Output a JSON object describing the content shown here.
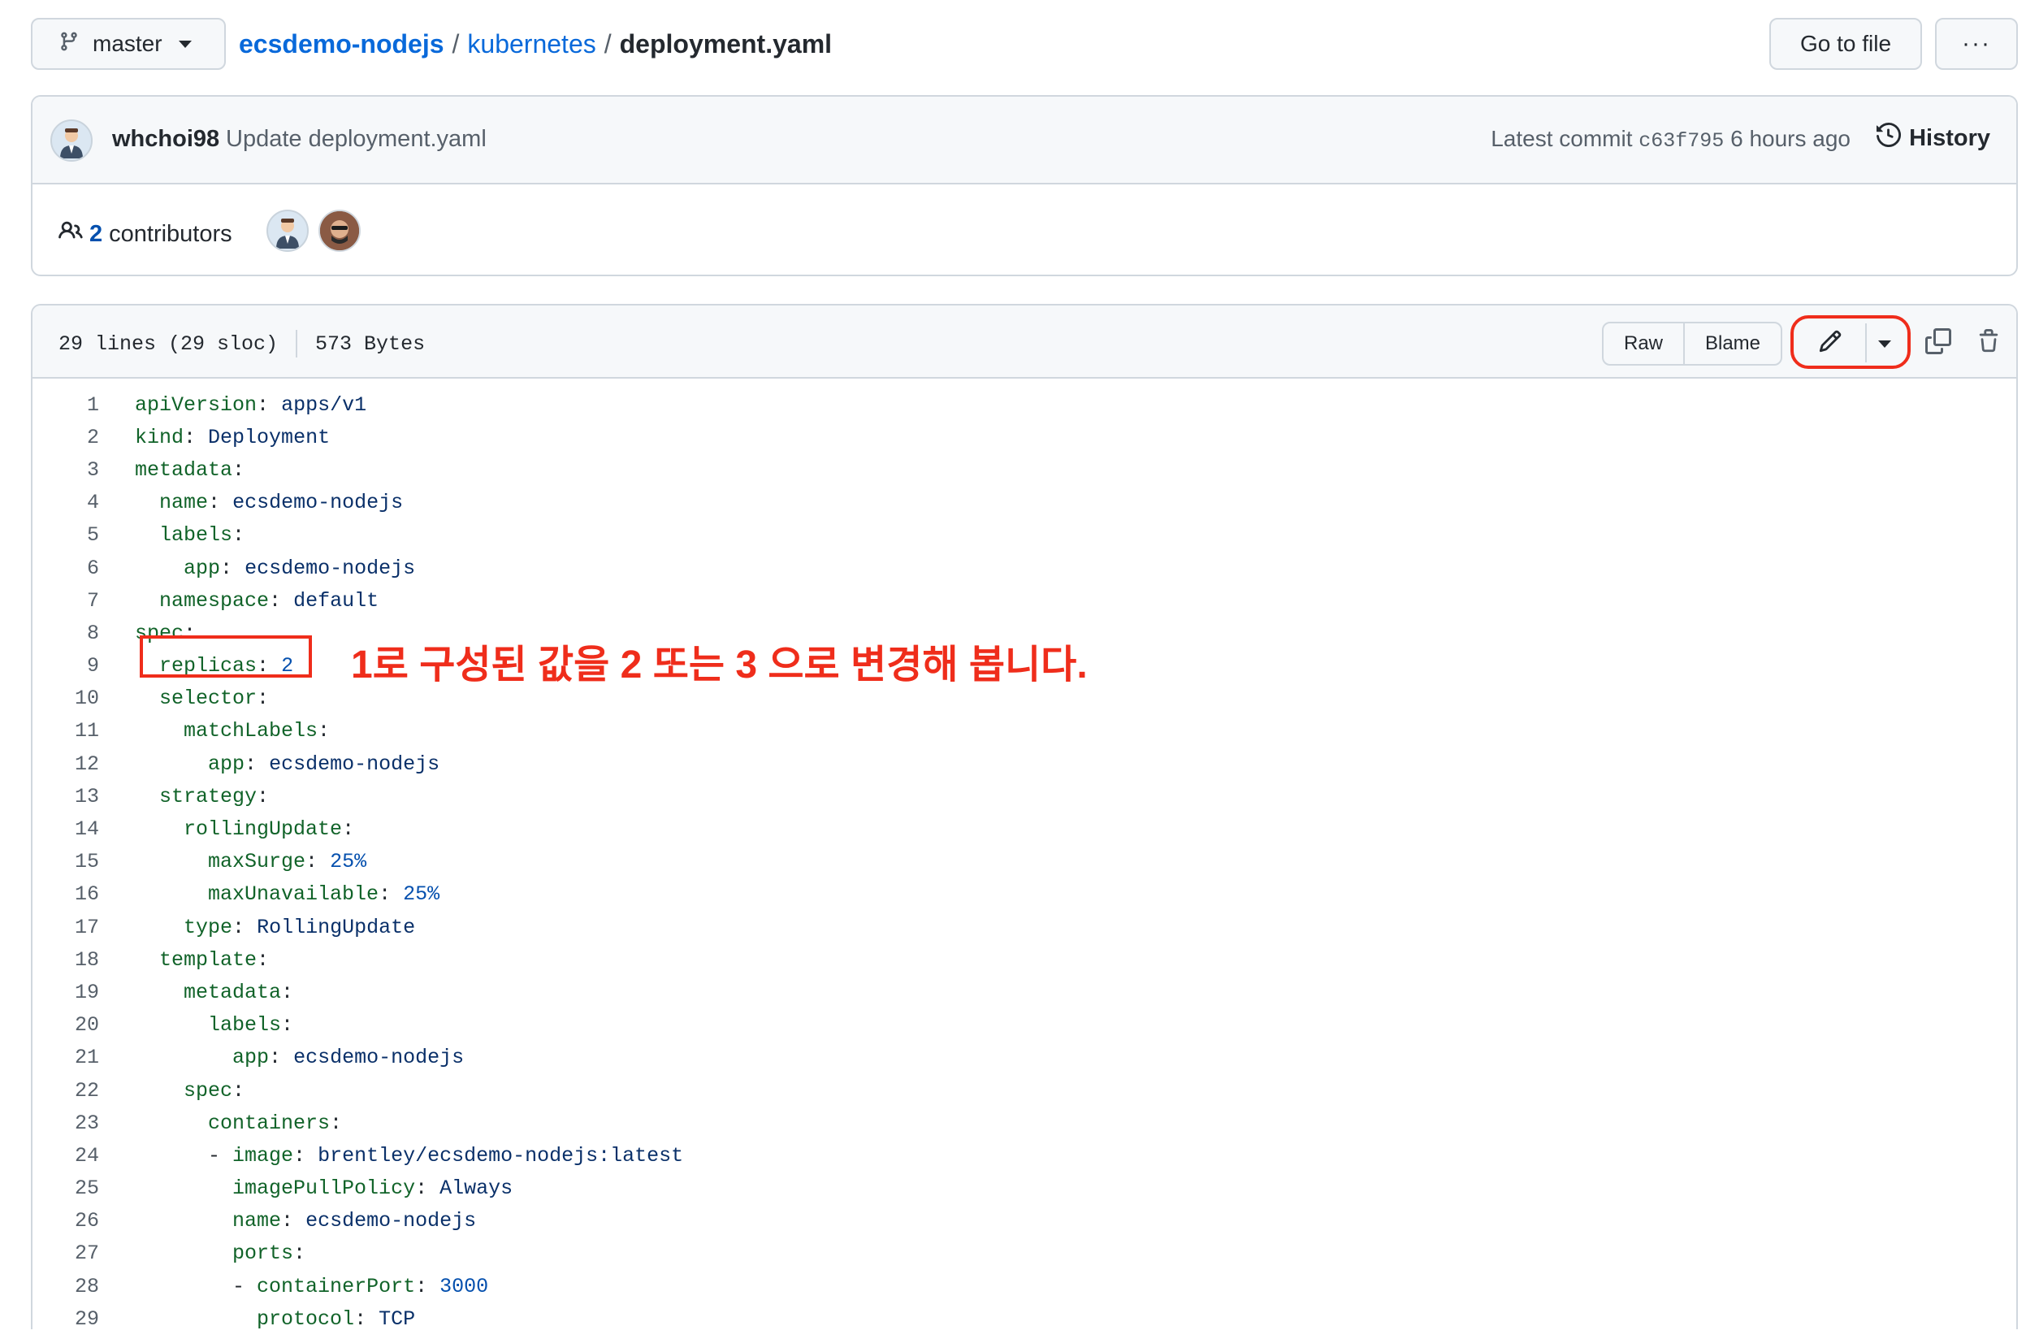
{
  "header": {
    "branch": "master",
    "breadcrumb": {
      "repo": "ecsdemo-nodejs",
      "separator": "/",
      "folder": "kubernetes",
      "file": "deployment.yaml"
    },
    "goto_file_label": "Go to file",
    "more_label": "···"
  },
  "commit": {
    "author": "whchoi98",
    "message": "Update deployment.yaml",
    "latest_label": "Latest commit",
    "sha": "c63f795",
    "time": "6 hours ago",
    "history_label": "History"
  },
  "contributors": {
    "count": "2",
    "label": "contributors"
  },
  "file": {
    "lines_info": "29 lines (29 sloc)",
    "size": "573 Bytes",
    "raw_label": "Raw",
    "blame_label": "Blame"
  },
  "code_lines": [
    {
      "n": "1",
      "indent": "",
      "key": "apiVersion",
      "prefix": "",
      "value": "apps/v1",
      "value_type": "str"
    },
    {
      "n": "2",
      "indent": "",
      "key": "kind",
      "prefix": "",
      "value": "Deployment",
      "value_type": "str"
    },
    {
      "n": "3",
      "indent": "",
      "key": "metadata",
      "prefix": "",
      "value": "",
      "value_type": "str"
    },
    {
      "n": "4",
      "indent": "  ",
      "key": "name",
      "prefix": "",
      "value": "ecsdemo-nodejs",
      "value_type": "str"
    },
    {
      "n": "5",
      "indent": "  ",
      "key": "labels",
      "prefix": "",
      "value": "",
      "value_type": "str"
    },
    {
      "n": "6",
      "indent": "    ",
      "key": "app",
      "prefix": "",
      "value": "ecsdemo-nodejs",
      "value_type": "str"
    },
    {
      "n": "7",
      "indent": "  ",
      "key": "namespace",
      "prefix": "",
      "value": "default",
      "value_type": "str"
    },
    {
      "n": "8",
      "indent": "",
      "key": "spec",
      "prefix": "",
      "value": "",
      "value_type": "str"
    },
    {
      "n": "9",
      "indent": "  ",
      "key": "replicas",
      "prefix": "",
      "value": "2",
      "value_type": "num"
    },
    {
      "n": "10",
      "indent": "  ",
      "key": "selector",
      "prefix": "",
      "value": "",
      "value_type": "str"
    },
    {
      "n": "11",
      "indent": "    ",
      "key": "matchLabels",
      "prefix": "",
      "value": "",
      "value_type": "str"
    },
    {
      "n": "12",
      "indent": "      ",
      "key": "app",
      "prefix": "",
      "value": "ecsdemo-nodejs",
      "value_type": "str"
    },
    {
      "n": "13",
      "indent": "  ",
      "key": "strategy",
      "prefix": "",
      "value": "",
      "value_type": "str"
    },
    {
      "n": "14",
      "indent": "    ",
      "key": "rollingUpdate",
      "prefix": "",
      "value": "",
      "value_type": "str"
    },
    {
      "n": "15",
      "indent": "      ",
      "key": "maxSurge",
      "prefix": "",
      "value": "25%",
      "value_type": "num"
    },
    {
      "n": "16",
      "indent": "      ",
      "key": "maxUnavailable",
      "prefix": "",
      "value": "25%",
      "value_type": "num"
    },
    {
      "n": "17",
      "indent": "    ",
      "key": "type",
      "prefix": "",
      "value": "RollingUpdate",
      "value_type": "str"
    },
    {
      "n": "18",
      "indent": "  ",
      "key": "template",
      "prefix": "",
      "value": "",
      "value_type": "str"
    },
    {
      "n": "19",
      "indent": "    ",
      "key": "metadata",
      "prefix": "",
      "value": "",
      "value_type": "str"
    },
    {
      "n": "20",
      "indent": "      ",
      "key": "labels",
      "prefix": "",
      "value": "",
      "value_type": "str"
    },
    {
      "n": "21",
      "indent": "        ",
      "key": "app",
      "prefix": "",
      "value": "ecsdemo-nodejs",
      "value_type": "str"
    },
    {
      "n": "22",
      "indent": "    ",
      "key": "spec",
      "prefix": "",
      "value": "",
      "value_type": "str"
    },
    {
      "n": "23",
      "indent": "      ",
      "key": "containers",
      "prefix": "",
      "value": "",
      "value_type": "str"
    },
    {
      "n": "24",
      "indent": "      ",
      "key": "image",
      "prefix": "- ",
      "value": "brentley/ecsdemo-nodejs:latest",
      "value_type": "str"
    },
    {
      "n": "25",
      "indent": "        ",
      "key": "imagePullPolicy",
      "prefix": "",
      "value": "Always",
      "value_type": "str"
    },
    {
      "n": "26",
      "indent": "        ",
      "key": "name",
      "prefix": "",
      "value": "ecsdemo-nodejs",
      "value_type": "str"
    },
    {
      "n": "27",
      "indent": "        ",
      "key": "ports",
      "prefix": "",
      "value": "",
      "value_type": "str"
    },
    {
      "n": "28",
      "indent": "        ",
      "key": "containerPort",
      "prefix": "- ",
      "value": "3000",
      "value_type": "num"
    },
    {
      "n": "29",
      "indent": "          ",
      "key": "protocol",
      "prefix": "",
      "value": "TCP",
      "value_type": "str"
    }
  ],
  "annotation": {
    "text": "1로 구성된 값을 2 또는 3 으로 변경해 봅니다."
  },
  "icons": {
    "branch": "git-branch-icon",
    "history": "history-clock-icon",
    "people": "people-icon",
    "edit": "pencil-icon",
    "copy": "copy-icon",
    "delete": "trash-icon"
  },
  "colors": {
    "link": "#0969da",
    "annotation_red": "#ef2d1b",
    "yaml_key": "#116329",
    "yaml_value": "#0a3069",
    "yaml_number": "#0550ae"
  }
}
